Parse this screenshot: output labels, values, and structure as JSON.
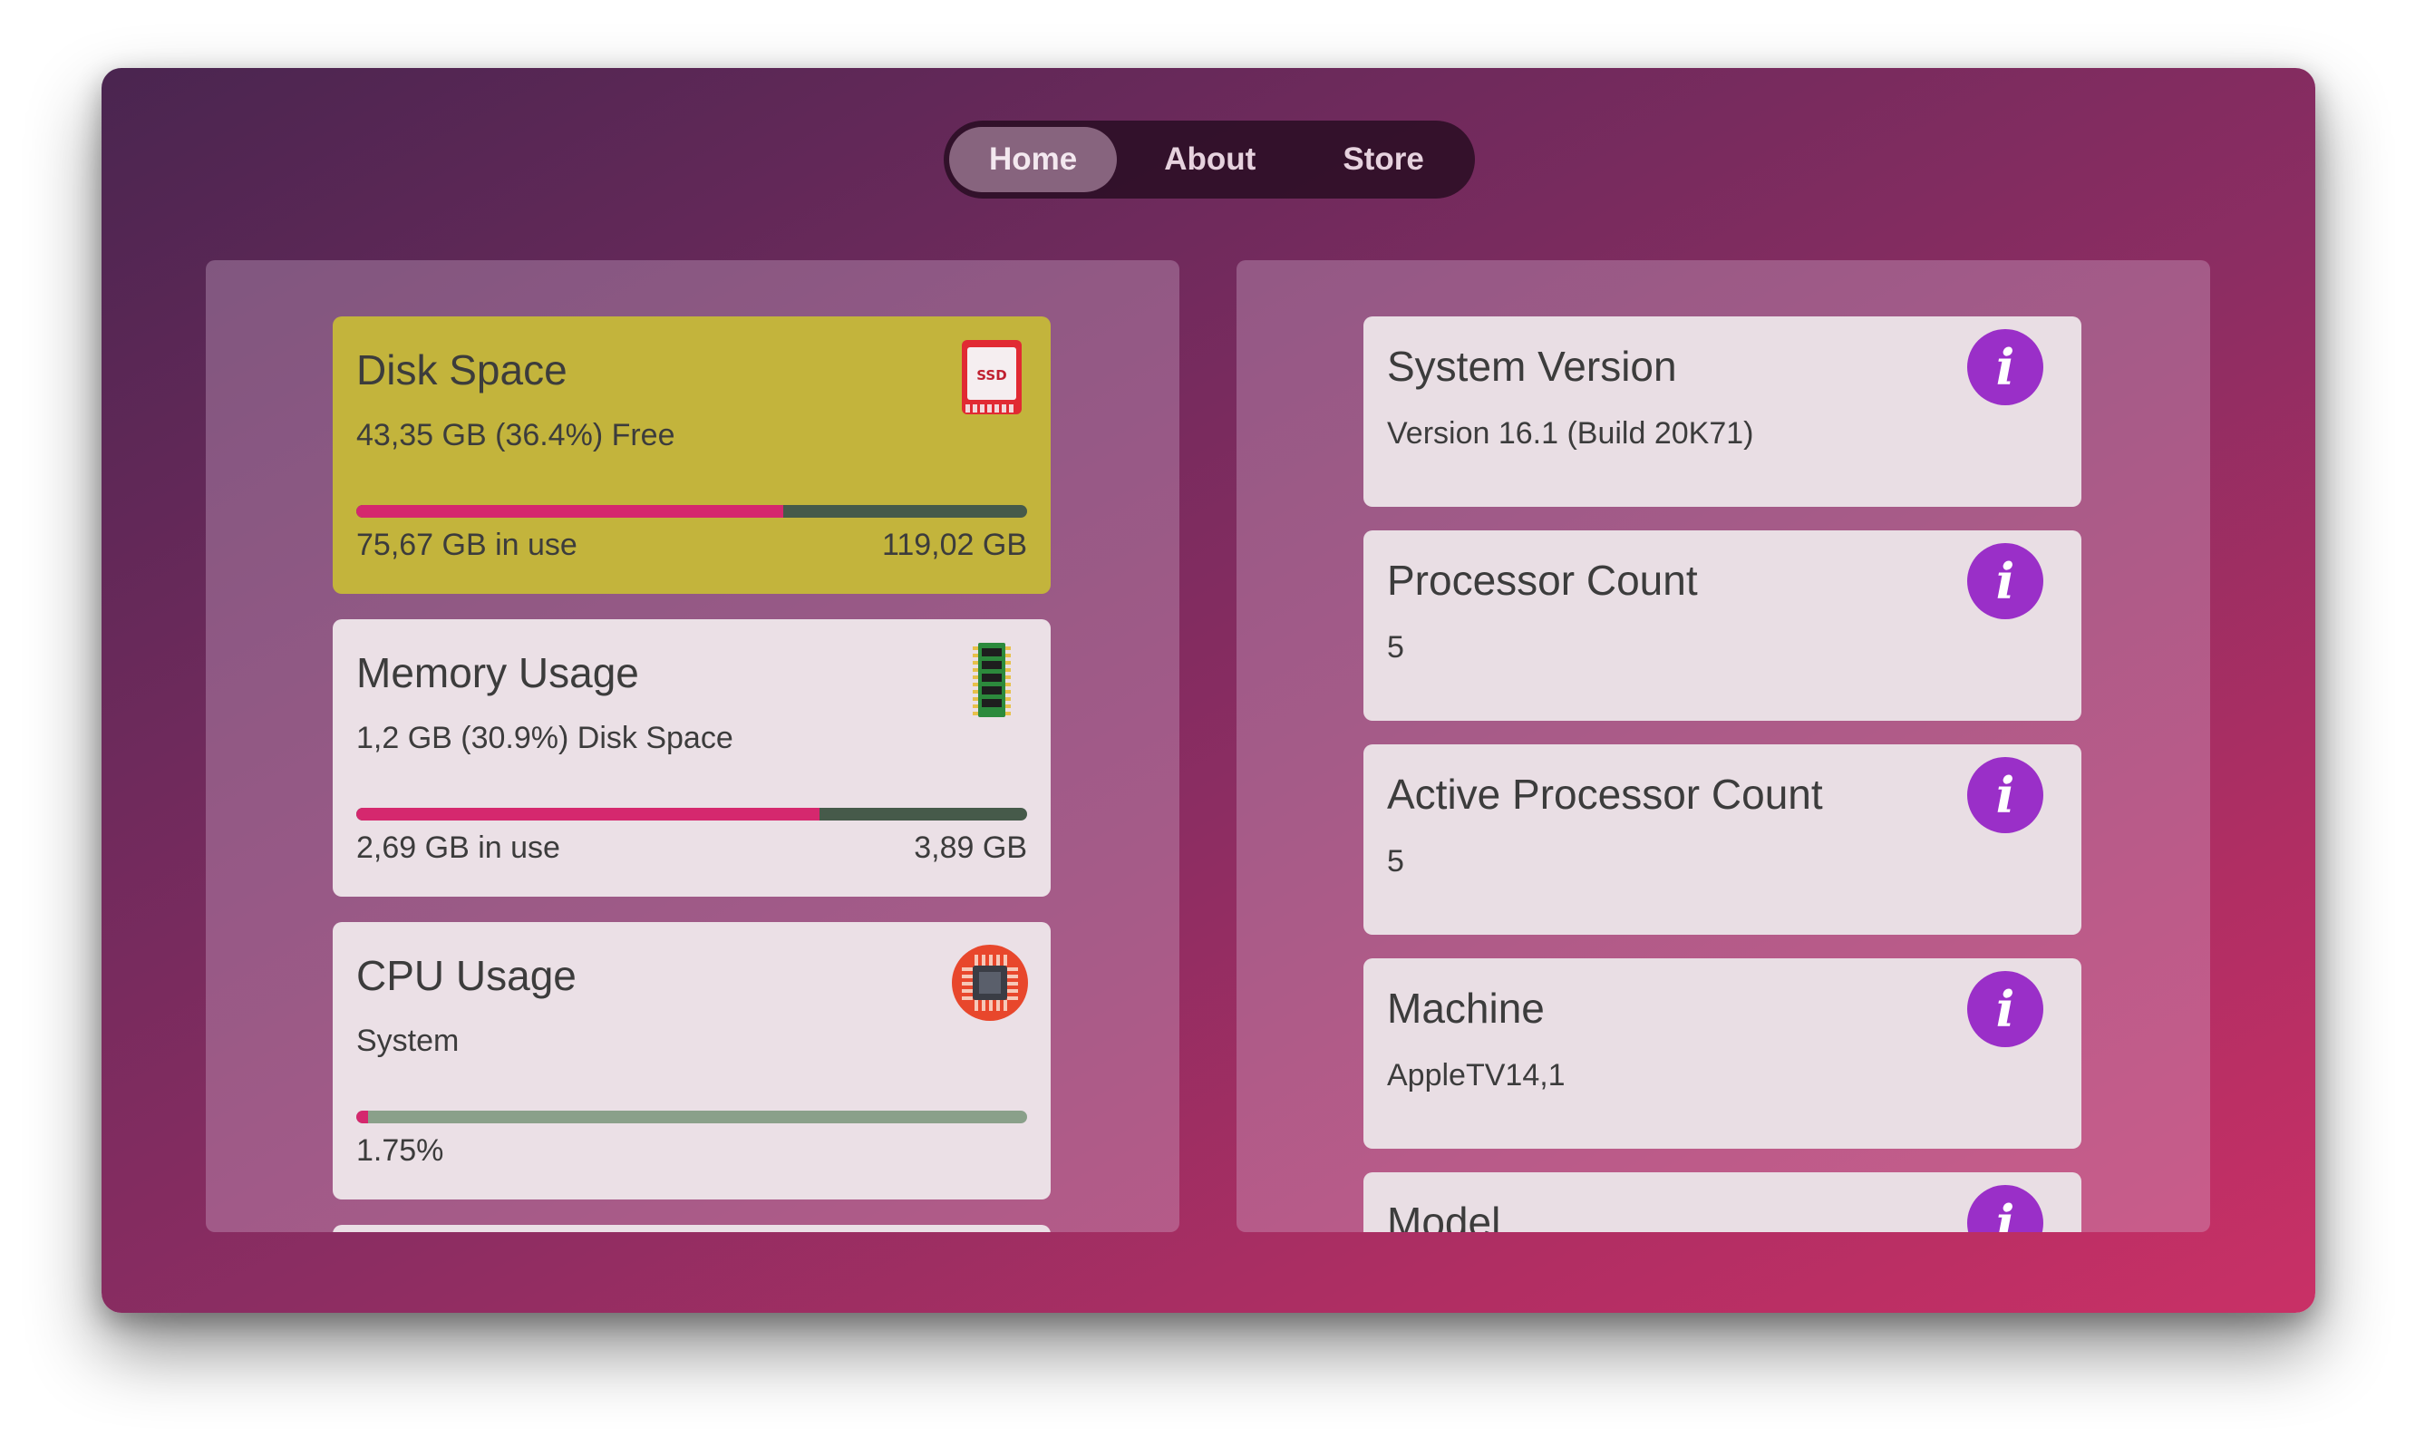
{
  "nav": {
    "tabs": [
      {
        "label": "Home",
        "active": true
      },
      {
        "label": "About",
        "active": false
      },
      {
        "label": "Store",
        "active": false
      }
    ]
  },
  "stats": [
    {
      "title": "Disk Space",
      "subtitle": "43,35 GB (36.4%) Free",
      "used_fraction": 0.636,
      "left_label": "75,67 GB in use",
      "right_label": "119,02 GB",
      "icon": "ssd-icon",
      "highlight": true
    },
    {
      "title": "Memory Usage",
      "subtitle": "1,2 GB (30.9%) Disk Space",
      "used_fraction": 0.691,
      "left_label": "2,69 GB in use",
      "right_label": "3,89 GB",
      "icon": "memory-chip-icon",
      "highlight": false
    },
    {
      "title": "CPU Usage",
      "subtitle": "System",
      "used_fraction": 0.0175,
      "left_label": "1.75%",
      "right_label": "",
      "icon": "cpu-chip-icon",
      "highlight": false
    }
  ],
  "info": [
    {
      "title": "System Version",
      "value": "Version 16.1 (Build 20K71)"
    },
    {
      "title": "Processor Count",
      "value": "5"
    },
    {
      "title": "Active Processor Count",
      "value": "5"
    },
    {
      "title": "Machine",
      "value": "AppleTV14,1"
    },
    {
      "title": "Model",
      "value": ""
    }
  ],
  "info_icon_glyph": "i",
  "colors": {
    "accent_bar": "#d5286e",
    "disk_card": "#c3b43c",
    "info_icon": "#9a2fc8"
  }
}
